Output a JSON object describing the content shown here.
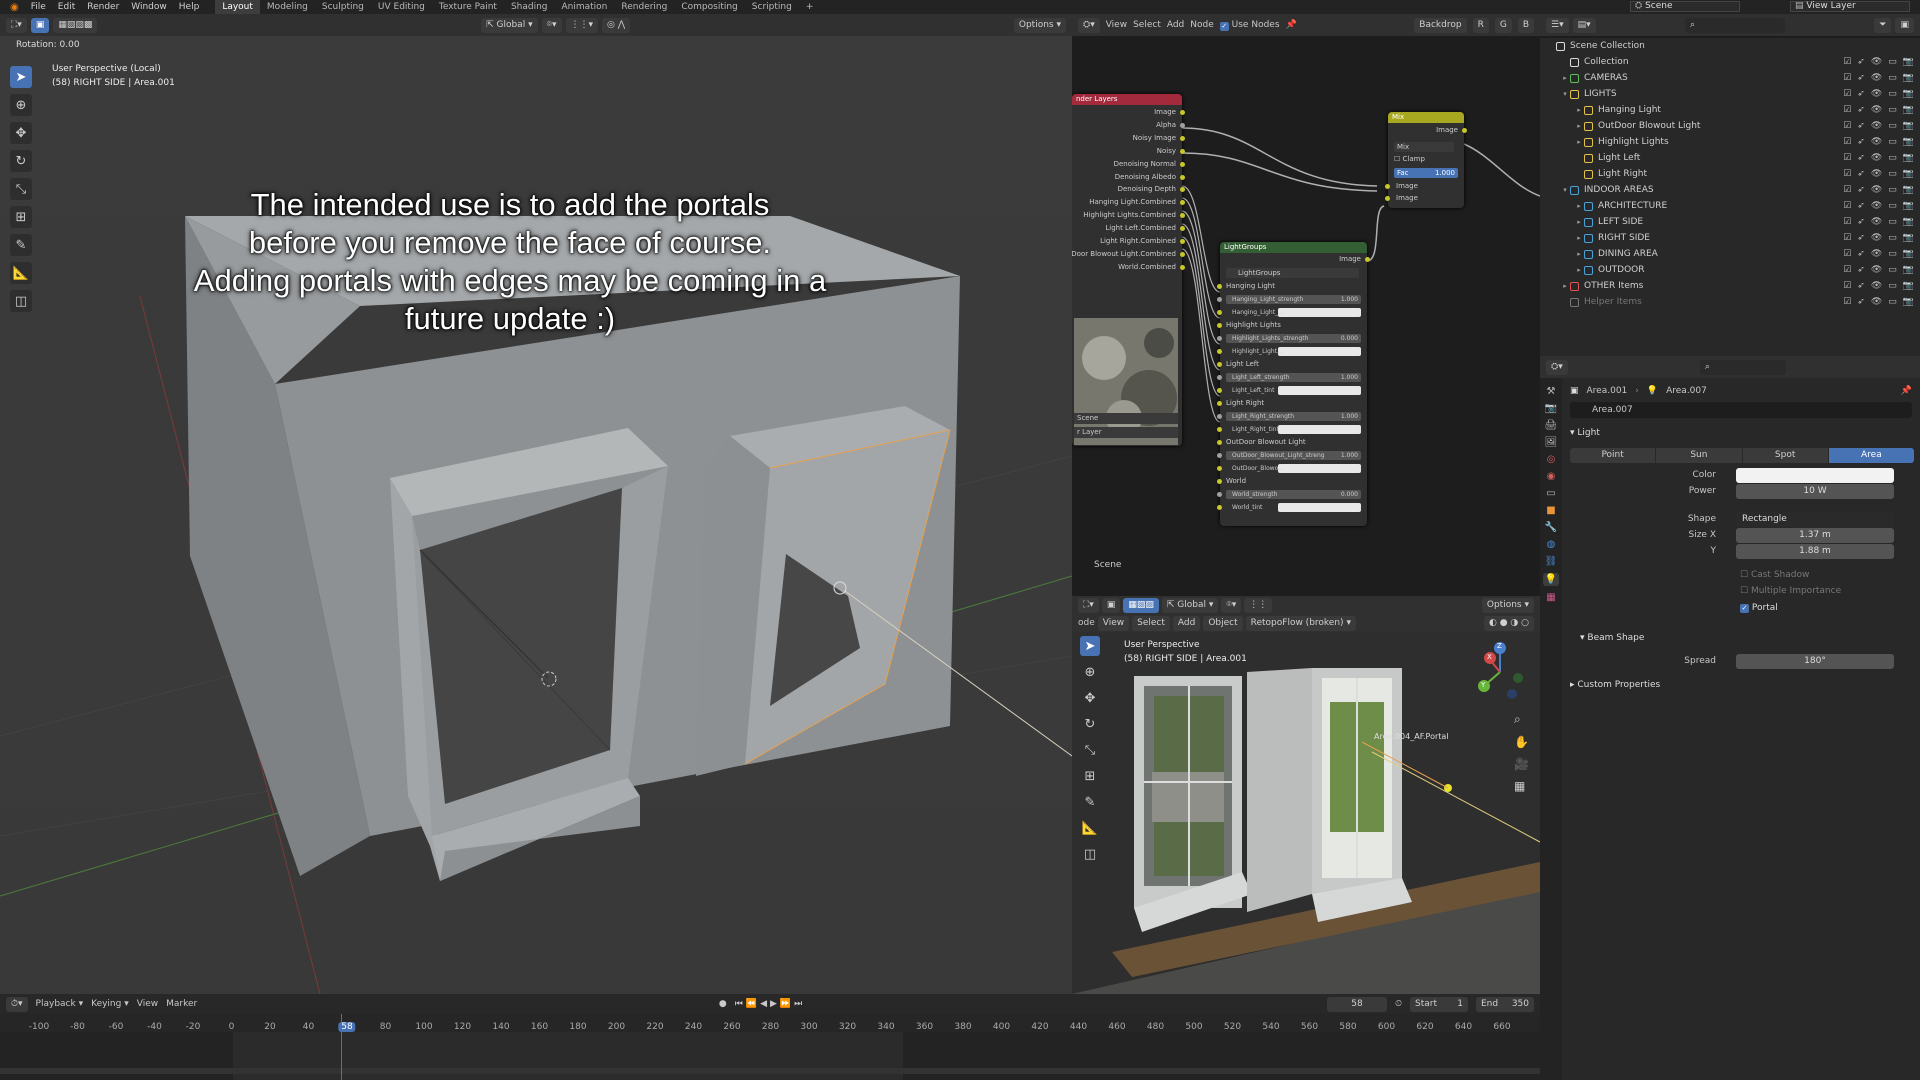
{
  "top_menu": {
    "items": [
      "File",
      "Edit",
      "Render",
      "Window",
      "Help"
    ],
    "workspaces": [
      "Layout",
      "Modeling",
      "Sculpting",
      "UV Editing",
      "Texture Paint",
      "Shading",
      "Animation",
      "Rendering",
      "Compositing",
      "Scripting"
    ],
    "active_workspace": "Layout",
    "add_tab": "+",
    "scene": "Scene",
    "view_layer": "View Layer"
  },
  "viewport": {
    "transform_orientation": "Global",
    "options_label": "Options",
    "rotation_readout": "Rotation: 0.00",
    "view_name": "User Perspective (Local)",
    "object_info": "(58) RIGHT SIDE | Area.001",
    "overlay_lines": [
      "The intended use is to add the portals",
      "before you remove the face of course.",
      "Adding portals with edges may be coming in a",
      "future update :)"
    ]
  },
  "node_editor": {
    "menu": [
      "View",
      "Select",
      "Add",
      "Node"
    ],
    "use_nodes_label": "Use Nodes",
    "backdrop_label": "Backdrop",
    "channel_letters": [
      "R",
      "G",
      "B"
    ],
    "scene_label": "Scene",
    "render_layers": {
      "title": "nder Layers",
      "outputs": [
        "Image",
        "Alpha",
        "Noisy Image",
        "Noisy",
        "Denoising Normal",
        "Denoising Albedo",
        "Denoising Depth",
        "Hanging Light.Combined",
        "Highlight Lights.Combined",
        "Light Left.Combined",
        "Light Right.Combined",
        "OutDoor Blowout Light.Combined",
        "World.Combined"
      ],
      "scene_field": "Scene",
      "layer_field": "r Layer"
    },
    "mix": {
      "title": "Mix",
      "output": "Image",
      "blend": "Mix",
      "clamp": "Clamp",
      "fac_label": "Fac",
      "fac_value": "1.000",
      "inputs": [
        "Image",
        "Image"
      ]
    },
    "light_groups": {
      "title": "LightGroups",
      "output": "Image",
      "group_name": "LightGroups",
      "rows": [
        {
          "label": "Hanging Light",
          "type": "label"
        },
        {
          "label": "Hanging_Light_strength",
          "value": "1.000",
          "type": "num"
        },
        {
          "label": "Hanging_Light_...",
          "value": "",
          "type": "color"
        },
        {
          "label": "Highlight Lights",
          "type": "label"
        },
        {
          "label": "Highlight_Lights_strength",
          "value": "0.000",
          "type": "num"
        },
        {
          "label": "Highlight_Light...",
          "value": "",
          "type": "color"
        },
        {
          "label": "Light Left",
          "type": "label"
        },
        {
          "label": "Light_Left_strength",
          "value": "1.000",
          "type": "num"
        },
        {
          "label": "Light_Left_tint",
          "value": "",
          "type": "color"
        },
        {
          "label": "Light Right",
          "type": "label"
        },
        {
          "label": "Light_Right_strength",
          "value": "1.000",
          "type": "num"
        },
        {
          "label": "Light_Right_tint",
          "value": "",
          "type": "color"
        },
        {
          "label": "OutDoor Blowout Light",
          "type": "label"
        },
        {
          "label": "OutDoor_Blowout_Light_streng",
          "value": "1.000",
          "type": "num"
        },
        {
          "label": "OutDoor_Blowo...",
          "value": "",
          "type": "color"
        },
        {
          "label": "World",
          "type": "label"
        },
        {
          "label": "World_strength",
          "value": "0.000",
          "type": "num"
        },
        {
          "label": "World_tint",
          "value": "",
          "type": "color"
        }
      ]
    }
  },
  "small_viewport": {
    "menu": [
      "ode",
      "View",
      "Select",
      "Add",
      "Object"
    ],
    "retopo": "RetopoFlow (broken)",
    "transform_orientation": "Global",
    "options_label": "Options",
    "view_name": "User Perspective",
    "object_info": "(58) RIGHT SIDE | Area.001",
    "gizmo": {
      "x": "X",
      "y": "Y",
      "z": "Z"
    },
    "object_label": "Area.004_AF.Portal"
  },
  "outliner": {
    "rows": [
      {
        "name": "Scene Collection",
        "depth": 0,
        "color": "#dddddd",
        "arrow": ""
      },
      {
        "name": "Collection",
        "depth": 1,
        "color": "#dddddd",
        "arrow": ""
      },
      {
        "name": "CAMERAS",
        "depth": 1,
        "color": "#5fbf5f",
        "arrow": "▸"
      },
      {
        "name": "LIGHTS",
        "depth": 1,
        "color": "#e3c24b",
        "arrow": "▾"
      },
      {
        "name": "Hanging Light",
        "depth": 2,
        "color": "#e3c24b",
        "arrow": "▸"
      },
      {
        "name": "OutDoor Blowout Light",
        "depth": 2,
        "color": "#e3c24b",
        "arrow": "▸"
      },
      {
        "name": "Highlight Lights",
        "depth": 2,
        "color": "#e3c24b",
        "arrow": "▸"
      },
      {
        "name": "Light Left",
        "depth": 2,
        "color": "#e3c24b",
        "arrow": ""
      },
      {
        "name": "Light Right",
        "depth": 2,
        "color": "#e3c24b",
        "arrow": ""
      },
      {
        "name": "INDOOR AREAS",
        "depth": 1,
        "color": "#4aa3d8",
        "arrow": "▾"
      },
      {
        "name": "ARCHITECTURE",
        "depth": 2,
        "color": "#4aa3d8",
        "arrow": "▸"
      },
      {
        "name": "LEFT SIDE",
        "depth": 2,
        "color": "#4aa3d8",
        "arrow": "▸"
      },
      {
        "name": "RIGHT SIDE",
        "depth": 2,
        "color": "#4aa3d8",
        "arrow": "▸"
      },
      {
        "name": "DINING AREA",
        "depth": 2,
        "color": "#4aa3d8",
        "arrow": "▸"
      },
      {
        "name": "OUTDOOR",
        "depth": 2,
        "color": "#4aa3d8",
        "arrow": "▸"
      },
      {
        "name": "OTHER Items",
        "depth": 1,
        "color": "#e05252",
        "arrow": "▸"
      },
      {
        "name": "Helper Items",
        "depth": 1,
        "color": "#777777",
        "arrow": ""
      }
    ]
  },
  "properties": {
    "object_name": "Area.001",
    "data_name": "Area.007",
    "datablock": "Area.007",
    "section_light": "Light",
    "light_types": [
      "Point",
      "Sun",
      "Spot",
      "Area"
    ],
    "active_light_type": "Area",
    "color_label": "Color",
    "power_label": "Power",
    "power_value": "10 W",
    "shape_label": "Shape",
    "shape_value": "Rectangle",
    "size_x_label": "Size X",
    "size_x_value": "1.37 m",
    "size_y_label": "Y",
    "size_y_value": "1.88 m",
    "cast_shadow": "Cast Shadow",
    "multiple_importance": "Multiple Importance",
    "portal": "Portal",
    "beam_shape": "Beam Shape",
    "spread_label": "Spread",
    "spread_value": "180°",
    "custom_properties": "Custom Properties"
  },
  "timeline": {
    "menu": [
      "Playback",
      "Keying",
      "View",
      "Marker"
    ],
    "current_frame": "58",
    "start_label": "Start",
    "start_value": "1",
    "end_label": "End",
    "end_value": "350",
    "ticks": [
      "-100",
      "-80",
      "-60",
      "-40",
      "-20",
      "0",
      "20",
      "40",
      "58",
      "80",
      "100",
      "120",
      "140",
      "160",
      "180",
      "200",
      "220",
      "240",
      "260",
      "280",
      "300",
      "320",
      "340",
      "360",
      "380",
      "400",
      "420",
      "440",
      "460",
      "480",
      "500",
      "520",
      "540",
      "560",
      "580",
      "600",
      "620",
      "640",
      "660"
    ]
  },
  "colors": {
    "accent": "#4772b3",
    "render_layers_header": "#a3293d",
    "mix_header": "#a8a820",
    "group_header": "#345e34",
    "playhead": "#4772b3"
  }
}
